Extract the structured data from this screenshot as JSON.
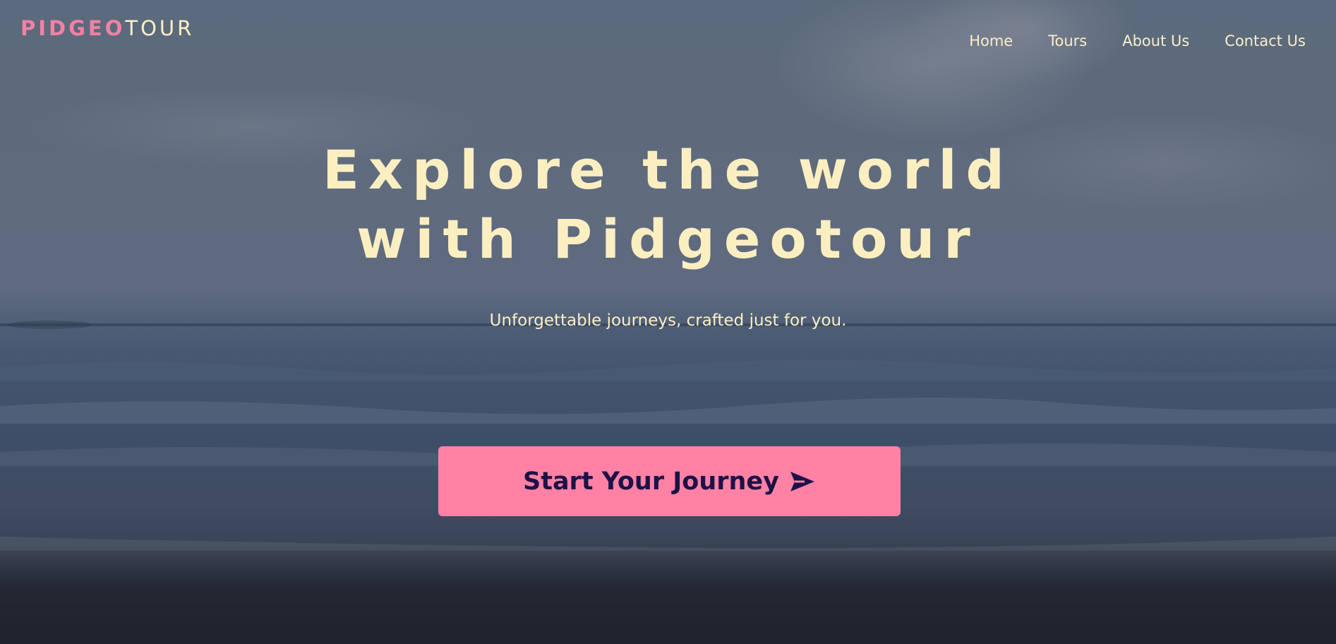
{
  "brand": {
    "name_bold": "PIDGEO",
    "name_light": "TOUR"
  },
  "nav": {
    "items": [
      {
        "label": "Home"
      },
      {
        "label": "Tours"
      },
      {
        "label": "About Us"
      },
      {
        "label": "Contact Us"
      }
    ]
  },
  "hero": {
    "headline_line1": "Explore the world",
    "headline_line2": "with Pidgeotour",
    "subtitle": "Unforgettable journeys, crafted just for you.",
    "cta_label": "Start Your Journey",
    "cta_icon": "send-arrow-icon"
  },
  "colors": {
    "brand_pink": "#f281a4",
    "cream_text": "#fbefc6",
    "cta_background": "#ff82a5",
    "cta_text": "#1d1247"
  }
}
